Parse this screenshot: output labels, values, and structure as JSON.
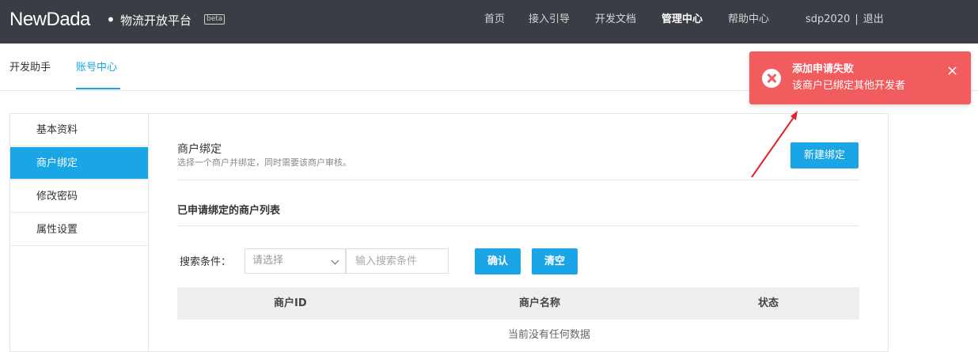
{
  "header": {
    "logo": "NewDada",
    "dot": "•",
    "platform": "物流开放平台",
    "beta": "beta",
    "nav": [
      "首页",
      "接入引导",
      "开发文档",
      "管理中心",
      "帮助中心"
    ],
    "active_nav": "管理中心",
    "user": "sdp2020",
    "separator": "|",
    "logout": "退出"
  },
  "subtabs": [
    "开发助手",
    "账号中心"
  ],
  "sidebar": {
    "items": [
      "基本资料",
      "商户绑定",
      "修改密码",
      "属性设置"
    ]
  },
  "main": {
    "title": "商户绑定",
    "desc": "选择一个商户并绑定，同时需要该商户审核。",
    "new_button": "新建绑定",
    "list_title": "已申请绑定的商户列表",
    "search_label": "搜索条件：",
    "select_placeholder": "请选择",
    "input_placeholder": "输入搜索条件",
    "confirm_button": "确认",
    "clear_button": "清空",
    "columns": [
      "商户ID",
      "商户名称",
      "状态"
    ],
    "empty_text": "当前没有任何数据"
  },
  "toast": {
    "title": "添加申请失败",
    "message": "该商户已绑定其他开发者",
    "close": "×"
  },
  "colors": {
    "accent": "#1aa6e6",
    "topbar": "#3a3d43",
    "toast": "#f15c5e",
    "arrow": "#e0242b"
  },
  "icons": [
    "error-icon",
    "close-icon",
    "chevron-down-icon"
  ]
}
